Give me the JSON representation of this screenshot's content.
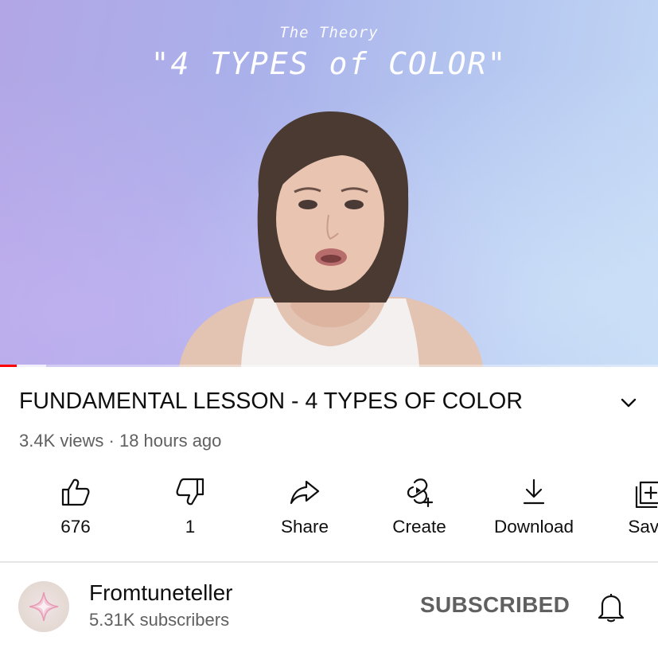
{
  "video": {
    "overlay_subtitle": "The Theory",
    "overlay_title": "\"4 TYPES of COLOR\"",
    "progress_fraction": 0.025,
    "buffer_fraction": 0.07,
    "progress_color": "#ff0000"
  },
  "details": {
    "title": "FUNDAMENTAL LESSON - 4 TYPES OF COLOR",
    "views": "3.4K views",
    "separator": "·",
    "posted": "18 hours ago",
    "expand_icon": "chevron-down-icon"
  },
  "actions": [
    {
      "id": "like",
      "label": "676",
      "icon": "thumbs-up-icon"
    },
    {
      "id": "dislike",
      "label": "1",
      "icon": "thumbs-down-icon"
    },
    {
      "id": "share",
      "label": "Share",
      "icon": "share-arrow-icon"
    },
    {
      "id": "create",
      "label": "Create",
      "icon": "create-icon"
    },
    {
      "id": "download",
      "label": "Download",
      "icon": "download-icon"
    },
    {
      "id": "save",
      "label": "Save",
      "icon": "save-playlist-icon"
    }
  ],
  "channel": {
    "name": "Fromtuneteller",
    "subscribers": "5.31K subscribers",
    "subscribe_label": "SUBSCRIBED",
    "bell_icon": "bell-icon"
  }
}
